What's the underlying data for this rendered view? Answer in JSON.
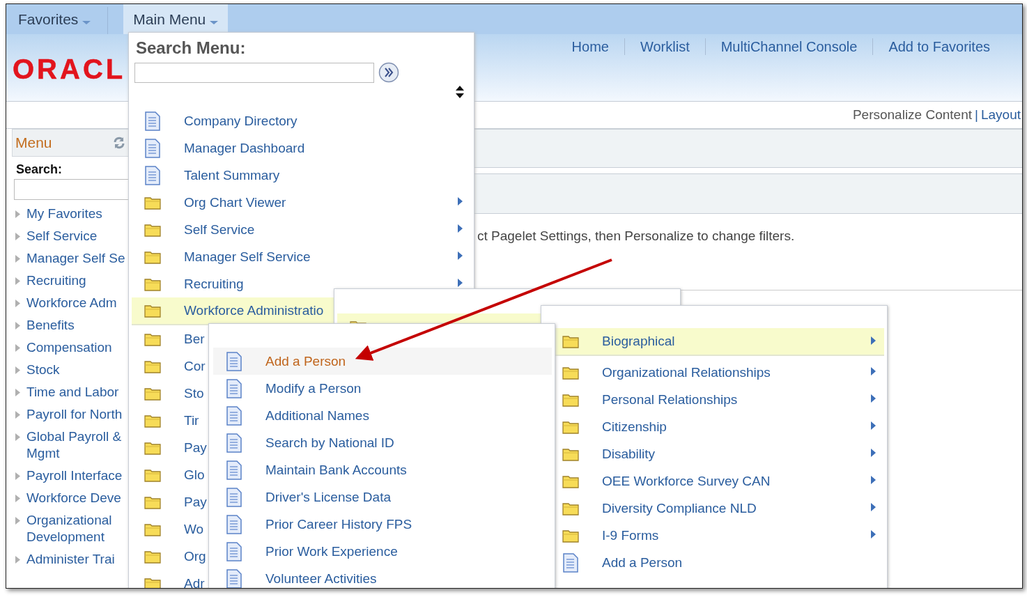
{
  "top_tabs": [
    {
      "label": "Favorites",
      "selected": false
    },
    {
      "label": "Main Menu",
      "selected": true
    }
  ],
  "logo": "ORACL",
  "nav_links": [
    "Home",
    "Worklist",
    "MultiChannel Console",
    "Add to Favorites"
  ],
  "personalize": {
    "content": "Personalize Content",
    "separator": "|",
    "layout": "Layout"
  },
  "left_menu": {
    "title": "Menu",
    "search_label": "Search:",
    "items": [
      "My Favorites",
      "Self Service",
      "Manager Self Se",
      "Recruiting",
      "Workforce Adm",
      "Benefits",
      "Compensation",
      "Stock",
      "Time and Labor",
      "Payroll for North",
      "Global Payroll & Mgmt",
      "Payroll Interface",
      "Workforce Deve",
      "Organizational Development",
      "Administer Trai"
    ]
  },
  "hint_text": "ct Pagelet Settings, then Personalize to change filters.",
  "main_menu": {
    "title": "Search Menu:",
    "items": [
      {
        "label": "Company Directory",
        "kind": "page",
        "arrow": false,
        "selected": false
      },
      {
        "label": "Manager Dashboard",
        "kind": "page",
        "arrow": false,
        "selected": false
      },
      {
        "label": "Talent Summary",
        "kind": "page",
        "arrow": false,
        "selected": false
      },
      {
        "label": "Org Chart Viewer",
        "kind": "folder",
        "arrow": true,
        "selected": false
      },
      {
        "label": "Self Service",
        "kind": "folder",
        "arrow": true,
        "selected": false
      },
      {
        "label": "Manager Self Service",
        "kind": "folder",
        "arrow": true,
        "selected": false
      },
      {
        "label": "Recruiting",
        "kind": "folder",
        "arrow": true,
        "selected": false
      },
      {
        "label": "Workforce Administratio",
        "kind": "folder",
        "arrow": false,
        "selected": true
      },
      {
        "label": "Ber",
        "kind": "folder",
        "arrow": false,
        "selected": false
      },
      {
        "label": "Cor",
        "kind": "folder",
        "arrow": false,
        "selected": false
      },
      {
        "label": "Sto",
        "kind": "folder",
        "arrow": false,
        "selected": false
      },
      {
        "label": "Tir",
        "kind": "folder",
        "arrow": false,
        "selected": false
      },
      {
        "label": "Pay",
        "kind": "folder",
        "arrow": false,
        "selected": false
      },
      {
        "label": "Glo",
        "kind": "folder",
        "arrow": false,
        "selected": false
      },
      {
        "label": "Pay",
        "kind": "folder",
        "arrow": false,
        "selected": false
      },
      {
        "label": "Wo",
        "kind": "folder",
        "arrow": false,
        "selected": false
      },
      {
        "label": "Org",
        "kind": "folder",
        "arrow": false,
        "selected": false
      },
      {
        "label": "Adr",
        "kind": "folder",
        "arrow": false,
        "selected": false
      }
    ]
  },
  "submenus": [
    {
      "items": [
        {
          "kind": "folder",
          "arrow": false,
          "selected": true
        }
      ]
    },
    {
      "items": [
        {
          "label": "Biographical",
          "kind": "folder",
          "arrow": true,
          "selected": true
        },
        {
          "label": "Organizational Relationships",
          "kind": "folder",
          "arrow": true,
          "selected": false
        },
        {
          "label": "Personal Relationships",
          "kind": "folder",
          "arrow": true,
          "selected": false
        },
        {
          "label": "Citizenship",
          "kind": "folder",
          "arrow": true,
          "selected": false
        },
        {
          "label": "Disability",
          "kind": "folder",
          "arrow": true,
          "selected": false
        },
        {
          "label": "OEE Workforce Survey CAN",
          "kind": "folder",
          "arrow": true,
          "selected": false
        },
        {
          "label": "Diversity Compliance NLD",
          "kind": "folder",
          "arrow": true,
          "selected": false
        },
        {
          "label": "I-9 Forms",
          "kind": "folder",
          "arrow": true,
          "selected": false
        },
        {
          "label": "Add a Person",
          "kind": "page",
          "arrow": false,
          "selected": false
        }
      ]
    },
    {
      "items": [
        {
          "label": "Add a Person",
          "kind": "page",
          "arrow": false,
          "selected": false,
          "hovered": true
        },
        {
          "label": "Modify a Person",
          "kind": "page",
          "arrow": false,
          "selected": false,
          "hovered": false
        },
        {
          "label": "Additional Names",
          "kind": "page",
          "arrow": false,
          "selected": false,
          "hovered": false
        },
        {
          "label": "Search by National ID",
          "kind": "page",
          "arrow": false,
          "selected": false,
          "hovered": false
        },
        {
          "label": "Maintain Bank Accounts",
          "kind": "page",
          "arrow": false,
          "selected": false,
          "hovered": false
        },
        {
          "label": "Driver's License Data",
          "kind": "page",
          "arrow": false,
          "selected": false,
          "hovered": false
        },
        {
          "label": "Prior Career History FPS",
          "kind": "page",
          "arrow": false,
          "selected": false,
          "hovered": false
        },
        {
          "label": "Prior Work Experience",
          "kind": "page",
          "arrow": false,
          "selected": false,
          "hovered": false
        },
        {
          "label": "Volunteer Activities",
          "kind": "page",
          "arrow": false,
          "selected": false,
          "hovered": false
        }
      ]
    }
  ]
}
